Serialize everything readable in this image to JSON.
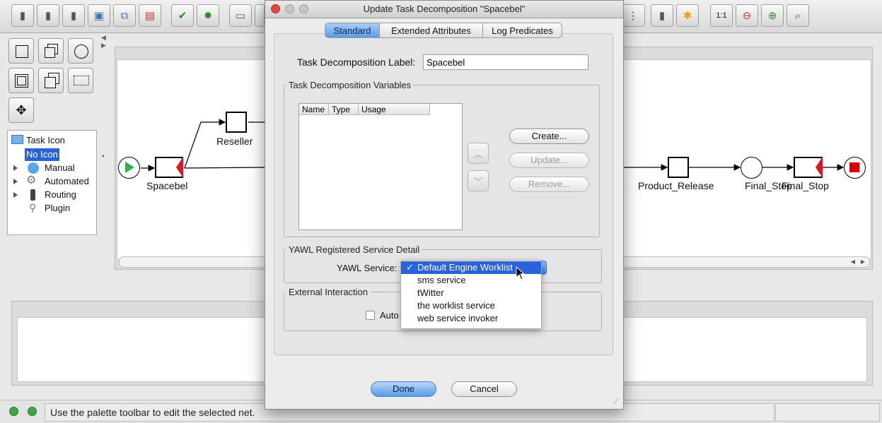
{
  "dialog": {
    "title": "Update Task Decomposition  \"Spacebel\"",
    "tabs": [
      {
        "label": "Standard",
        "active": true
      },
      {
        "label": "Extended Attributes",
        "active": false
      },
      {
        "label": "Log Predicates",
        "active": false
      }
    ],
    "label_field": {
      "label": "Task Decomposition Label:",
      "value": "Spacebel"
    },
    "variables": {
      "title": "Task Decomposition Variables",
      "columns": [
        "Name",
        "Type",
        "Usage"
      ],
      "buttons": {
        "create": "Create...",
        "update": "Update...",
        "remove": "Remove..."
      }
    },
    "service": {
      "title": "YAWL Registered Service Detail",
      "label": "YAWL Service:",
      "options": [
        {
          "label": "Default Engine Worklist",
          "checked": true
        },
        {
          "label": "sms service",
          "checked": false
        },
        {
          "label": "tWitter",
          "checked": false
        },
        {
          "label": "the worklist service",
          "checked": false
        },
        {
          "label": "web service invoker",
          "checked": false
        }
      ],
      "check_mark": "✓"
    },
    "external": {
      "title": "External Interaction",
      "checkbox_label": "Auto",
      "checked": false
    },
    "done_label": "Done",
    "cancel_label": "Cancel"
  },
  "tree": {
    "root": "Task Icon",
    "items": [
      {
        "label": "No Icon",
        "selected": true
      },
      {
        "label": "Manual",
        "expandable": true
      },
      {
        "label": "Automated",
        "expandable": true
      },
      {
        "label": "Routing",
        "expandable": true
      },
      {
        "label": "Plugin",
        "expandable": false
      }
    ]
  },
  "net": {
    "tasks": [
      "Spacebel",
      "Reseller",
      "Product_Release",
      "Final_Stop",
      "Final_Stop"
    ],
    "partial_label": "e"
  },
  "toolbar": {
    "zoom_reset": "1:1"
  },
  "status": {
    "message": "Use the palette toolbar to edit the selected net."
  },
  "colors": {
    "accent_blue": "#2a62d9",
    "start_green": "#2bb34a",
    "end_red": "#e00000"
  }
}
